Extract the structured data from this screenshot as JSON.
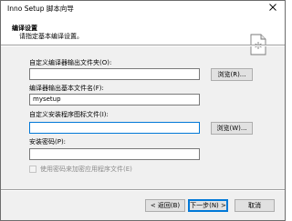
{
  "window": {
    "title": "Inno Setup 脚本向导"
  },
  "header": {
    "title": "编译设置",
    "subtitle": "请指定基本编译设置。"
  },
  "fields": {
    "output_folder": {
      "label": "自定义编译器输出文件夹(O):",
      "value": "",
      "browse_label": "浏览(R)..."
    },
    "output_basename": {
      "label": "编译器输出基本文件名(F):",
      "value": "mysetup"
    },
    "setup_icon": {
      "label": "自定义安装程序图标文件(I):",
      "value": "",
      "browse_label": "浏览(W)..."
    },
    "password": {
      "label": "安装密码(P):",
      "value": ""
    },
    "encrypt": {
      "label": "使用密码来加密应用程序文件(E)",
      "checked": false,
      "enabled": false
    }
  },
  "buttons": {
    "back": "< 返回(B)",
    "next": "下一步(N) >",
    "cancel": "取消"
  },
  "colors": {
    "dialog_bg": "#f0f0f0",
    "accent": "#0078d7"
  }
}
